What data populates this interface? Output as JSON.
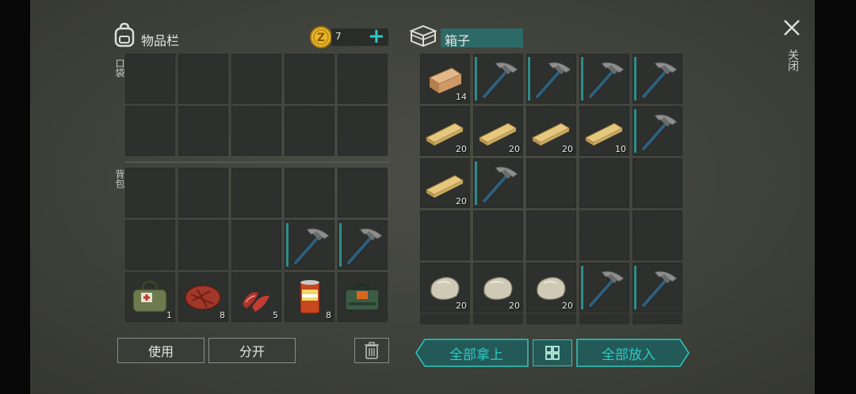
{
  "inventory": {
    "title": "物品栏",
    "coins": "7",
    "pocket_label": "口袋",
    "backpack_label": "背包",
    "pocket_slots": [
      [
        "",
        "",
        "",
        "",
        ""
      ],
      [
        "",
        "",
        "",
        "",
        ""
      ]
    ],
    "backpack_slots": [
      [
        {
          "icon": "",
          "qty": ""
        },
        {
          "icon": "",
          "qty": ""
        },
        {
          "icon": "",
          "qty": ""
        },
        {
          "icon": "",
          "qty": ""
        },
        {
          "icon": "",
          "qty": ""
        }
      ],
      [
        {
          "icon": "",
          "qty": ""
        },
        {
          "icon": "",
          "qty": ""
        },
        {
          "icon": "",
          "qty": ""
        },
        {
          "icon": "pickaxe-icon",
          "qty": ""
        },
        {
          "icon": "pickaxe-icon",
          "qty": ""
        }
      ],
      [
        {
          "icon": "medkit-bag-icon",
          "qty": "1"
        },
        {
          "icon": "steak-icon",
          "qty": "8"
        },
        {
          "icon": "meat-slices-icon",
          "qty": "5"
        },
        {
          "icon": "canned-food-icon",
          "qty": "8"
        },
        {
          "icon": "explosive-pack-icon",
          "qty": ""
        }
      ]
    ],
    "use_label": "使用",
    "split_label": "分开"
  },
  "chest": {
    "title": "箱子",
    "slots": [
      [
        {
          "icon": "wood-log-icon",
          "qty": "14"
        },
        {
          "icon": "pickaxe-icon",
          "qty": ""
        },
        {
          "icon": "pickaxe-icon",
          "qty": ""
        },
        {
          "icon": "pickaxe-icon",
          "qty": ""
        },
        {
          "icon": "pickaxe-icon",
          "qty": ""
        }
      ],
      [
        {
          "icon": "wood-plank-icon",
          "qty": "20"
        },
        {
          "icon": "wood-plank-icon",
          "qty": "20"
        },
        {
          "icon": "wood-plank-icon",
          "qty": "20"
        },
        {
          "icon": "wood-plank-icon",
          "qty": "10"
        },
        {
          "icon": "pickaxe-icon",
          "qty": ""
        }
      ],
      [
        {
          "icon": "wood-plank-icon",
          "qty": "20"
        },
        {
          "icon": "pickaxe-icon",
          "qty": ""
        },
        {
          "icon": "",
          "qty": ""
        },
        {
          "icon": "",
          "qty": ""
        },
        {
          "icon": "",
          "qty": ""
        }
      ],
      [
        {
          "icon": "",
          "qty": ""
        },
        {
          "icon": "",
          "qty": ""
        },
        {
          "icon": "",
          "qty": ""
        },
        {
          "icon": "",
          "qty": ""
        },
        {
          "icon": "",
          "qty": ""
        }
      ],
      [
        {
          "icon": "stone-icon",
          "qty": "20"
        },
        {
          "icon": "stone-icon",
          "qty": "20"
        },
        {
          "icon": "stone-icon",
          "qty": "20"
        },
        {
          "icon": "pickaxe-icon",
          "qty": ""
        },
        {
          "icon": "pickaxe-icon",
          "qty": ""
        }
      ]
    ],
    "take_all_label": "全部拿上",
    "put_all_label": "全部放入"
  },
  "close_label": "关闭",
  "colors": {
    "accent": "#2dc9c3",
    "slot": "#2d302d",
    "coin": "#e9b72c"
  }
}
